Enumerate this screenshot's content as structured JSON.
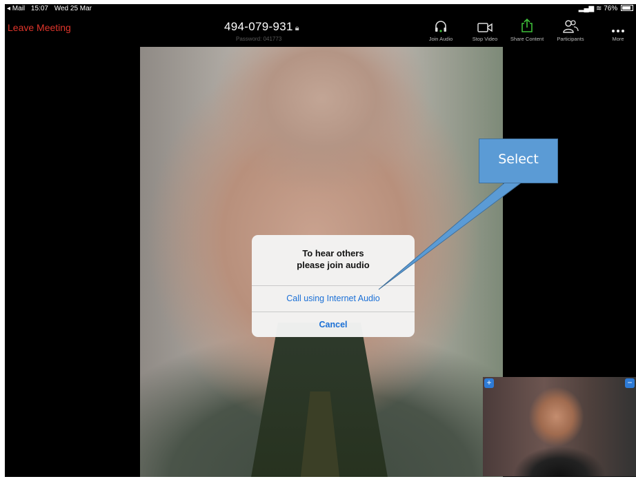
{
  "status_bar": {
    "back_app": "◂ Mail",
    "time": "15:07",
    "date": "Wed 25 Mar",
    "battery": "76%"
  },
  "toolbar": {
    "leave_label": "Leave Meeting",
    "meeting_id": "494-079-931",
    "password": "Password: 041773",
    "tools": [
      {
        "label": "Join Audio",
        "icon": "headphones-icon"
      },
      {
        "label": "Stop Video",
        "icon": "video-camera-icon"
      },
      {
        "label": "Share Content",
        "icon": "share-icon"
      },
      {
        "label": "Participants",
        "icon": "participants-icon"
      },
      {
        "label": "More",
        "icon": "more-icon"
      }
    ]
  },
  "dialog": {
    "message_line1": "To hear others",
    "message_line2": "please join audio",
    "option_internet_audio": "Call using Internet Audio",
    "option_cancel": "Cancel"
  },
  "annotation": {
    "callout_text": "Select"
  },
  "colors": {
    "leave": "#e0352b",
    "share": "#3fbf3a",
    "link": "#1a6fd6",
    "callout": "#5b9bd5"
  }
}
